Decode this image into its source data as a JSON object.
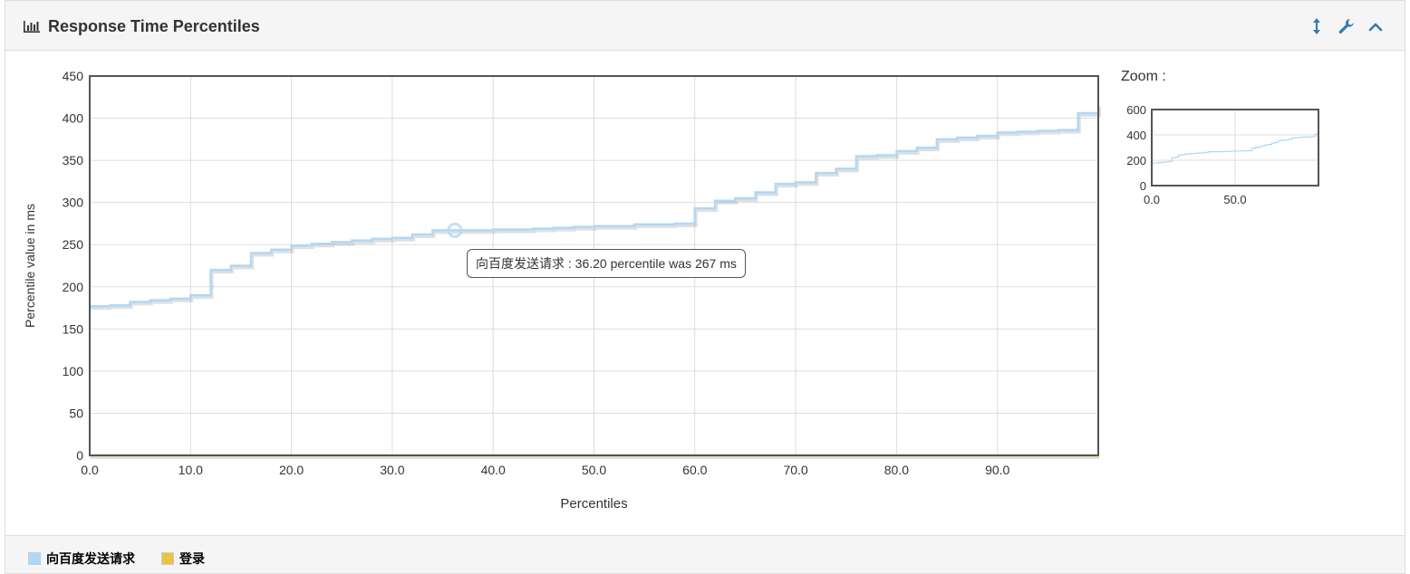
{
  "panel": {
    "title": "Response Time Percentiles",
    "title_icon": "bar-chart-icon",
    "tools": [
      {
        "name": "expand-icon",
        "glyph": "↕"
      },
      {
        "name": "wrench-icon",
        "glyph": "wrench"
      },
      {
        "name": "collapse-icon",
        "glyph": "chevron-up"
      }
    ]
  },
  "zoom": {
    "label": "Zoom :"
  },
  "tooltip": {
    "text": "向百度发送请求 : 36.20 percentile was 267 ms"
  },
  "legend": [
    {
      "label": "向百度发送请求",
      "color": "#afd8f8"
    },
    {
      "label": "登录",
      "color": "#edc240"
    }
  ],
  "chart_data": {
    "type": "line",
    "title": "",
    "xlabel": "Percentiles",
    "ylabel": "Percentile value in ms",
    "xlim": [
      0,
      100
    ],
    "ylim": [
      0,
      450
    ],
    "xticks": [
      "0.0",
      "10.0",
      "20.0",
      "30.0",
      "40.0",
      "50.0",
      "60.0",
      "70.0",
      "80.0",
      "90.0"
    ],
    "yticks": [
      "0",
      "50",
      "100",
      "150",
      "200",
      "250",
      "300",
      "350",
      "400",
      "450"
    ],
    "grid": true,
    "legend_position": "bottom",
    "highlight": {
      "series": "向百度发送请求",
      "x": 36.2,
      "y": 267
    },
    "series": [
      {
        "name": "向百度发送请求",
        "color": "#afd8f8",
        "x": [
          0,
          2,
          4,
          6,
          8,
          10,
          12,
          14,
          16,
          18,
          20,
          22,
          24,
          26,
          28,
          30,
          32,
          34,
          36,
          38,
          40,
          42,
          44,
          46,
          48,
          50,
          52,
          54,
          56,
          58,
          60,
          62,
          64,
          66,
          68,
          70,
          72,
          74,
          76,
          78,
          80,
          82,
          84,
          86,
          88,
          90,
          92,
          94,
          96,
          98,
          100
        ],
        "y": [
          177,
          178,
          182,
          184,
          186,
          190,
          220,
          225,
          240,
          244,
          249,
          251,
          253,
          255,
          257,
          258,
          262,
          267,
          267,
          267,
          268,
          268,
          269,
          270,
          271,
          272,
          272,
          274,
          274,
          275,
          293,
          302,
          305,
          312,
          322,
          324,
          335,
          340,
          355,
          356,
          361,
          365,
          375,
          377,
          379,
          383,
          384,
          385,
          386,
          406,
          415
        ]
      },
      {
        "name": "登录",
        "color": "#edc240",
        "x": [
          0,
          100
        ],
        "y": [
          0,
          0
        ]
      }
    ],
    "zoom_chart": {
      "xlim": [
        0,
        100
      ],
      "ylim": [
        0,
        600
      ],
      "xticks": [
        "0.0",
        "50.0"
      ],
      "yticks": [
        "0",
        "200",
        "400",
        "600"
      ]
    }
  }
}
